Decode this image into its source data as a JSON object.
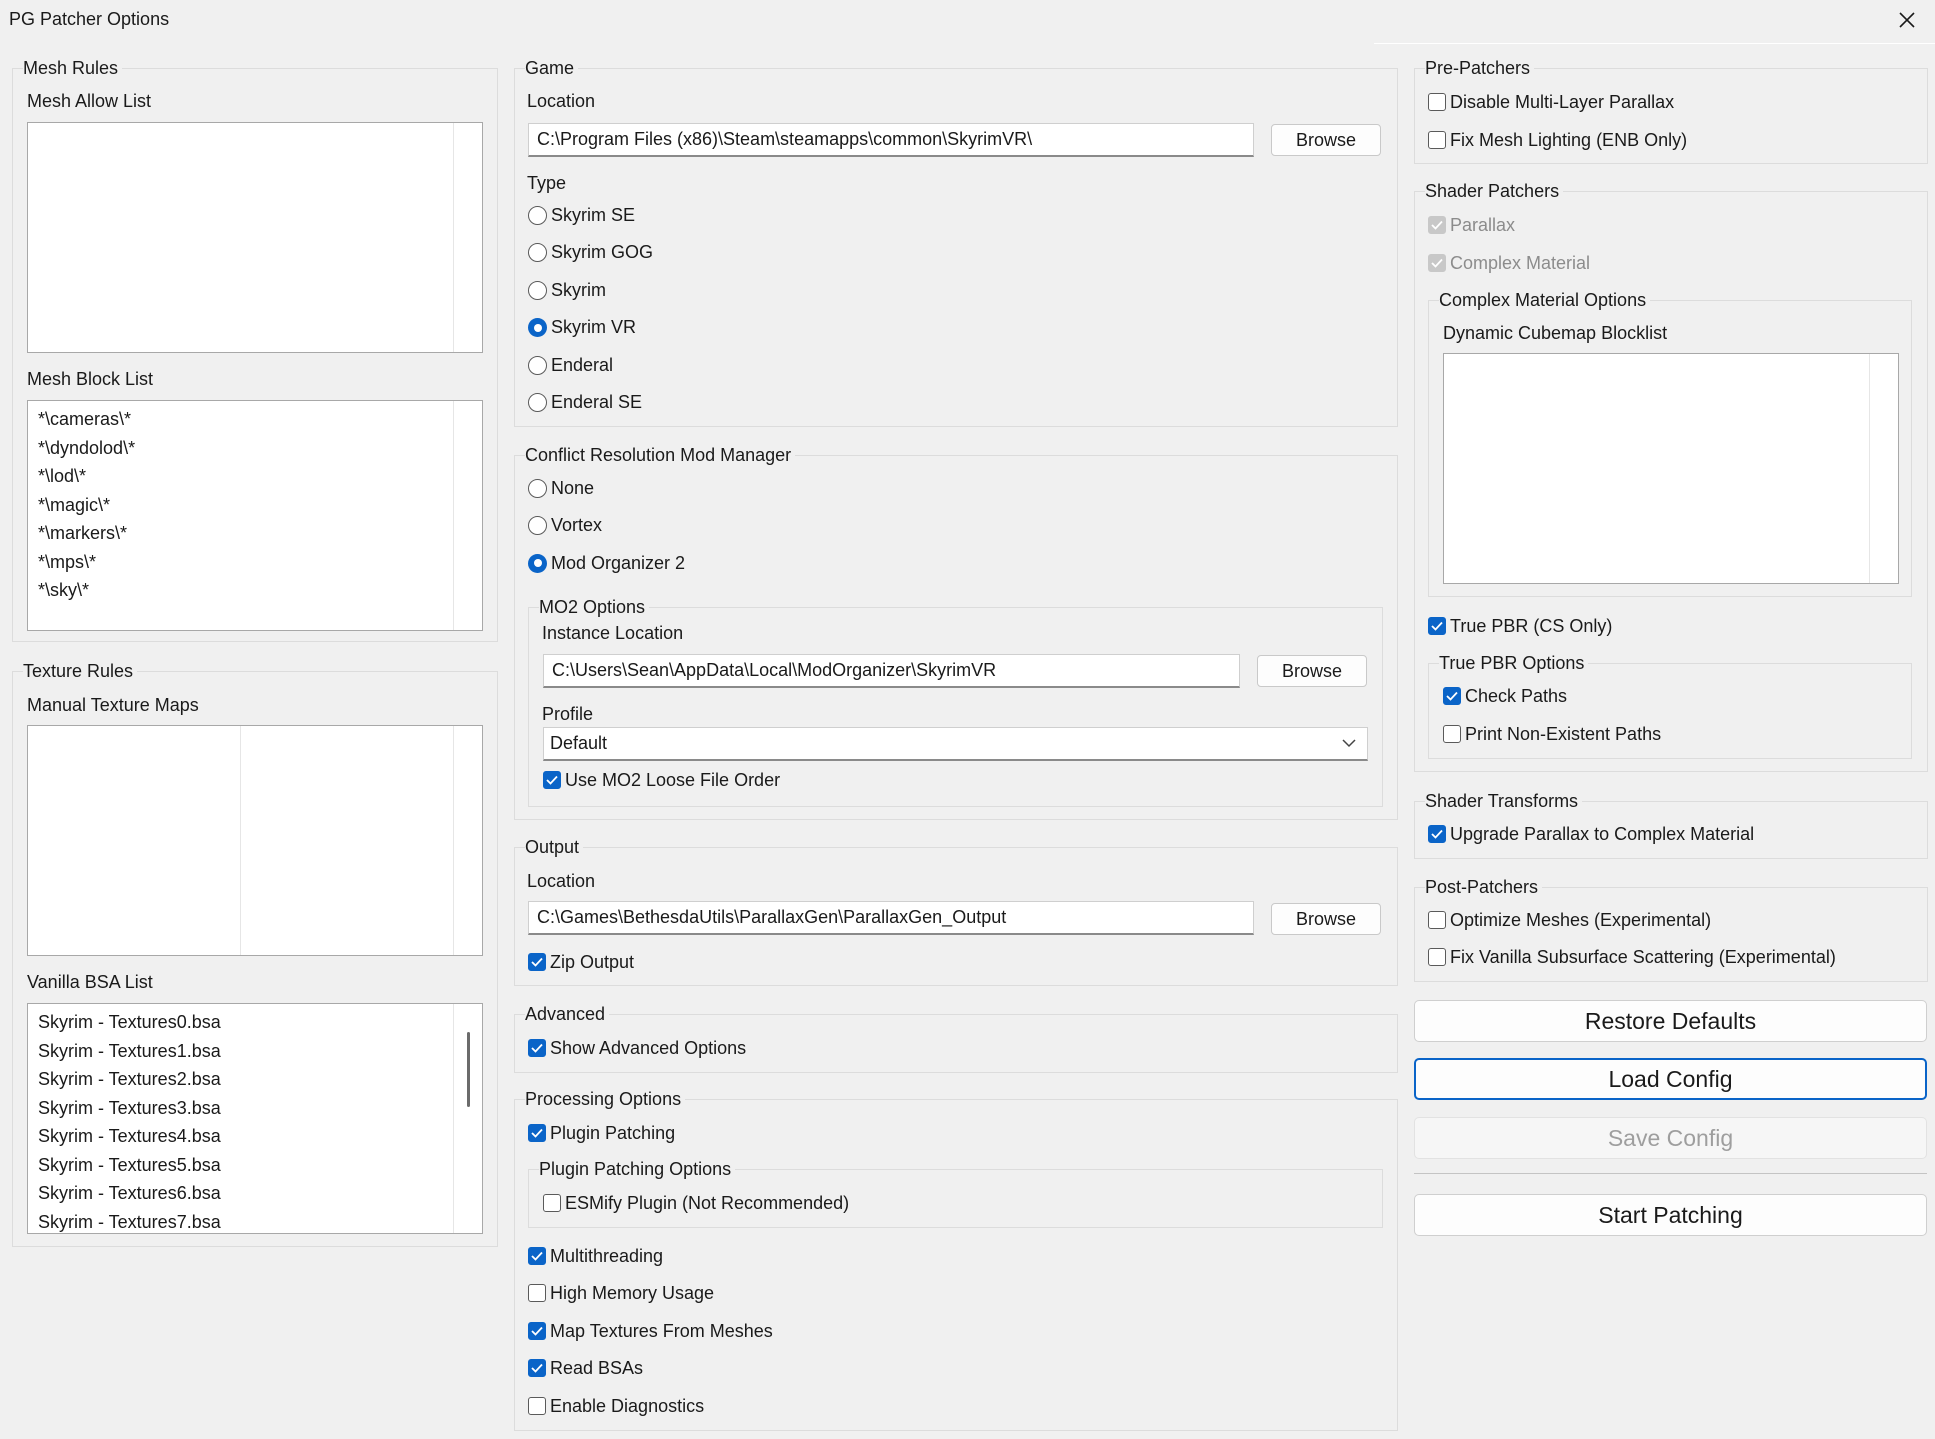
{
  "window": {
    "title": "PG Patcher Options"
  },
  "mesh_rules": {
    "legend": "Mesh Rules",
    "allow_label": "Mesh Allow List",
    "allow_items": [],
    "block_label": "Mesh Block List",
    "block_items": [
      "*\\cameras\\*",
      "*\\dyndolod\\*",
      "*\\lod\\*",
      "*\\magic\\*",
      "*\\markers\\*",
      "*\\mps\\*",
      "*\\sky\\*"
    ]
  },
  "texture_rules": {
    "legend": "Texture Rules",
    "manual_label": "Manual Texture Maps",
    "manual_items": [],
    "vanilla_label": "Vanilla BSA List",
    "vanilla_items": [
      "Skyrim - Textures0.bsa",
      "Skyrim - Textures1.bsa",
      "Skyrim - Textures2.bsa",
      "Skyrim - Textures3.bsa",
      "Skyrim - Textures4.bsa",
      "Skyrim - Textures5.bsa",
      "Skyrim - Textures6.bsa",
      "Skyrim - Textures7.bsa"
    ]
  },
  "game": {
    "legend": "Game",
    "location_label": "Location",
    "location_value": "C:\\Program Files (x86)\\Steam\\steamapps\\common\\SkyrimVR\\",
    "browse_label": "Browse",
    "type_label": "Type",
    "types": [
      "Skyrim SE",
      "Skyrim GOG",
      "Skyrim",
      "Skyrim VR",
      "Enderal",
      "Enderal SE"
    ],
    "selected_type": 3
  },
  "mod_manager": {
    "legend": "Conflict Resolution Mod Manager",
    "options": [
      "None",
      "Vortex",
      "Mod Organizer 2"
    ],
    "selected": 2,
    "mo2": {
      "legend": "MO2 Options",
      "instance_label": "Instance Location",
      "instance_value": "C:\\Users\\Sean\\AppData\\Local\\ModOrganizer\\SkyrimVR",
      "browse_label": "Browse",
      "profile_label": "Profile",
      "profile_value": "Default",
      "loose_order_label": "Use MO2 Loose File Order",
      "loose_order_checked": true
    }
  },
  "output": {
    "legend": "Output",
    "location_label": "Location",
    "location_value": "C:\\Games\\BethesdaUtils\\ParallaxGen\\ParallaxGen_Output",
    "browse_label": "Browse",
    "zip_label": "Zip Output",
    "zip_checked": true
  },
  "advanced": {
    "legend": "Advanced",
    "show_label": "Show Advanced Options",
    "show_checked": true
  },
  "processing": {
    "legend": "Processing Options",
    "plugin_patching_label": "Plugin Patching",
    "plugin_patching_checked": true,
    "plugin_options_legend": "Plugin Patching Options",
    "esmify_label": "ESMify Plugin (Not Recommended)",
    "esmify_checked": false,
    "multithreading_label": "Multithreading",
    "multithreading_checked": true,
    "high_memory_label": "High Memory Usage",
    "high_memory_checked": false,
    "map_textures_label": "Map Textures From Meshes",
    "map_textures_checked": true,
    "read_bsas_label": "Read BSAs",
    "read_bsas_checked": true,
    "diagnostics_label": "Enable Diagnostics",
    "diagnostics_checked": false
  },
  "pre_patchers": {
    "legend": "Pre-Patchers",
    "disable_mlp_label": "Disable Multi-Layer Parallax",
    "disable_mlp_checked": false,
    "fix_lighting_label": "Fix Mesh Lighting (ENB Only)",
    "fix_lighting_checked": false
  },
  "shader_patchers": {
    "legend": "Shader Patchers",
    "parallax_label": "Parallax",
    "complex_material_label": "Complex Material",
    "cm_options_legend": "Complex Material Options",
    "blocklist_label": "Dynamic Cubemap Blocklist",
    "blocklist_items": [],
    "true_pbr_label": "True PBR (CS Only)",
    "true_pbr_checked": true,
    "true_pbr_options_legend": "True PBR Options",
    "check_paths_label": "Check Paths",
    "check_paths_checked": true,
    "print_nonexistent_label": "Print Non-Existent Paths",
    "print_nonexistent_checked": false
  },
  "shader_transforms": {
    "legend": "Shader Transforms",
    "upgrade_label": "Upgrade Parallax to Complex Material",
    "upgrade_checked": true
  },
  "post_patchers": {
    "legend": "Post-Patchers",
    "optimize_label": "Optimize Meshes (Experimental)",
    "optimize_checked": false,
    "fix_sss_label": "Fix Vanilla Subsurface Scattering (Experimental)",
    "fix_sss_checked": false
  },
  "actions": {
    "restore_label": "Restore Defaults",
    "load_label": "Load Config",
    "save_label": "Save Config",
    "start_label": "Start Patching"
  },
  "colors": {
    "accent": "#0a64c8",
    "background": "#f0f0f0",
    "disabled_text": "#9e9e9e"
  }
}
